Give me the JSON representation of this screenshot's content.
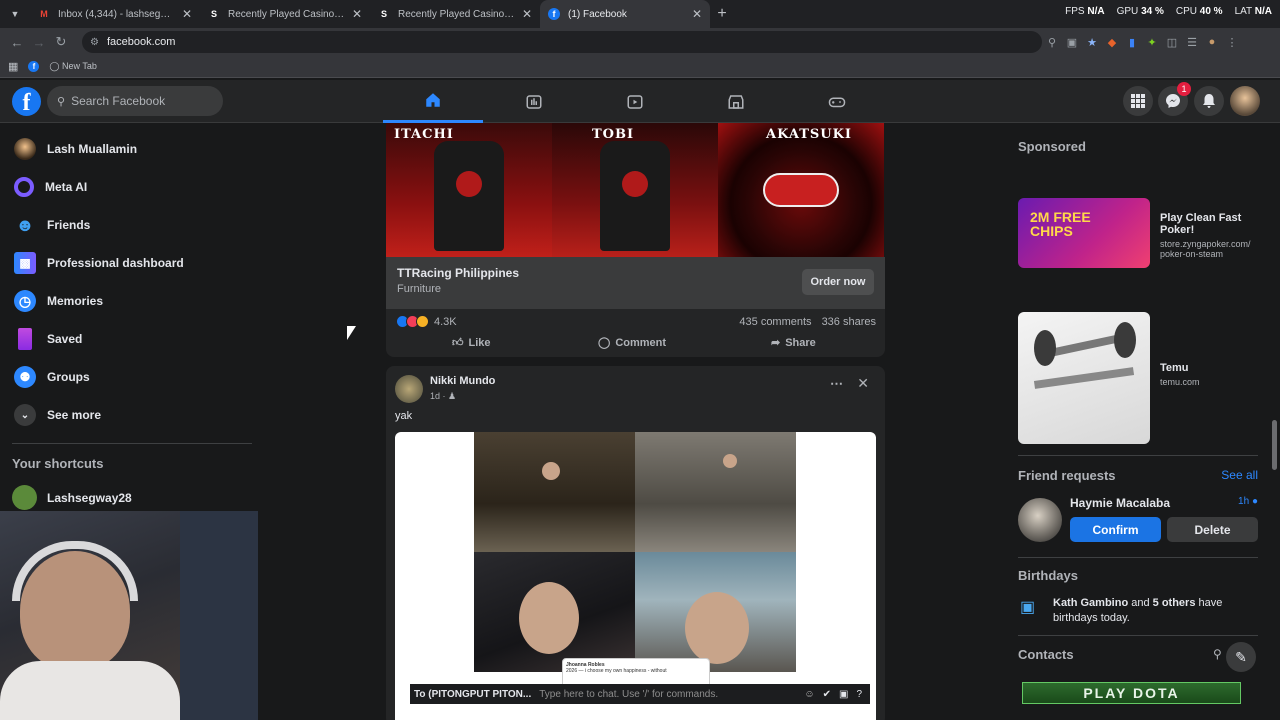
{
  "browser": {
    "tabs": [
      {
        "title": "Inbox (4,344) - lashsegway@gm",
        "icon": "gmail-icon",
        "active": false
      },
      {
        "title": "Recently Played Casino Games",
        "icon": "casino-icon",
        "active": false
      },
      {
        "title": "Recently Played Casino Games",
        "icon": "casino-icon",
        "active": false
      },
      {
        "title": "(1) Facebook",
        "icon": "facebook-icon",
        "active": true
      }
    ],
    "url": "facebook.com",
    "bookmark_newtab": "New Tab",
    "stats": {
      "fps_label": "FPS",
      "fps": "N/A",
      "gpu_label": "GPU",
      "gpu": "34 %",
      "cpu_label": "CPU",
      "cpu": "40 %",
      "lat_label": "LAT",
      "lat": "N/A"
    }
  },
  "fb": {
    "search_placeholder": "Search Facebook",
    "notification_count": "1"
  },
  "leftnav": {
    "items": [
      {
        "label": "Lash Muallamin",
        "icon": "profile-avatar"
      },
      {
        "label": "Meta AI",
        "icon": "meta-ai-icon"
      },
      {
        "label": "Friends",
        "icon": "friends-icon"
      },
      {
        "label": "Professional dashboard",
        "icon": "dashboard-icon"
      },
      {
        "label": "Memories",
        "icon": "clock-icon"
      },
      {
        "label": "Saved",
        "icon": "bookmark-icon"
      },
      {
        "label": "Groups",
        "icon": "groups-icon"
      },
      {
        "label": "See more",
        "icon": "chevron-down-icon"
      }
    ],
    "shortcuts_heading": "Your shortcuts",
    "shortcut": "Lashsegway28"
  },
  "ad_post": {
    "brands": [
      "ITACHI",
      "TOBI",
      "AKATSUKI"
    ],
    "advertiser": "TTRacing Philippines",
    "category": "Furniture",
    "cta": "Order now",
    "reactions": "4.3K",
    "comments": "435 comments",
    "shares": "336 shares",
    "like": "Like",
    "comment": "Comment",
    "share": "Share"
  },
  "post2": {
    "author": "Nikki Mundo",
    "time": "1d",
    "text": "yak",
    "tweet_author": "Jhoanna Robles",
    "tweet_text": "2026 — i choose my own happiness - without"
  },
  "right": {
    "sponsored": "Sponsored",
    "ads": [
      {
        "title": "Play Clean Fast Poker!",
        "domain": "store.zyngapoker.com/ poker-on-steam",
        "banner": "2M FREE CHIPS"
      },
      {
        "title": "Temu",
        "domain": "temu.com"
      }
    ],
    "friend_requests": "Friend requests",
    "see_all": "See all",
    "requester": "Haymie Macalaba",
    "request_time": "1h",
    "confirm": "Confirm",
    "delete": "Delete",
    "birthdays": "Birthdays",
    "birthday_name": "Kath Gambino",
    "birthday_and": "and",
    "birthday_others": "5 others",
    "birthday_rest": "have birthdays today.",
    "contacts": "Contacts"
  },
  "overlay": {
    "chat_to": "To (PITONGPUT PITON...",
    "chat_placeholder": "Type here to chat. Use '/' for commands.",
    "dota": "PLAY DOTA"
  }
}
